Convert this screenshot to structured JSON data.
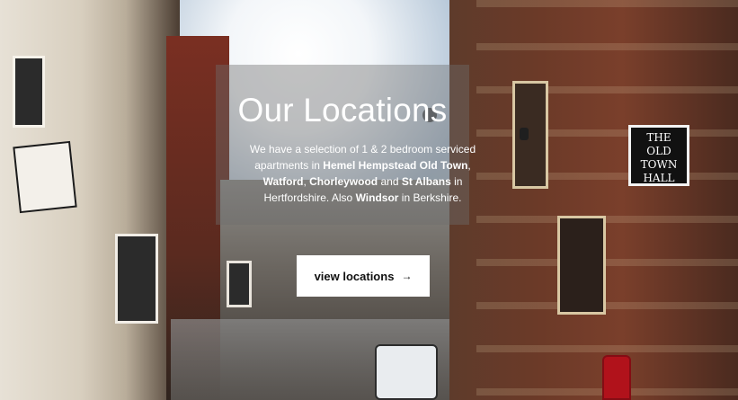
{
  "hero": {
    "title": "Our Locations",
    "description": {
      "p1": "We have a selection of 1 & 2 bedroom serviced apartments in ",
      "loc1": "Hemel Hempstead Old Town",
      "p2": ", ",
      "loc2": "Watford",
      "p3": ", ",
      "loc3": "Chorleywood",
      "p4": " and ",
      "loc4": "St Albans",
      "p5": " in Hertfordshire. Also ",
      "loc5": "Windsor",
      "p6": " in Berkshire."
    },
    "cta": {
      "label": "view locations",
      "icon": "arrow-right-icon",
      "arrow_glyph": "→"
    }
  },
  "signs": {
    "hall": {
      "top_text": "",
      "lines": [
        "THE",
        "OLD",
        "TOWN",
        "HALL"
      ]
    }
  },
  "colors": {
    "overlay": "#6e6e6e",
    "button_bg": "#ffffff",
    "text": "#ffffff",
    "postbox": "#b1121b"
  }
}
